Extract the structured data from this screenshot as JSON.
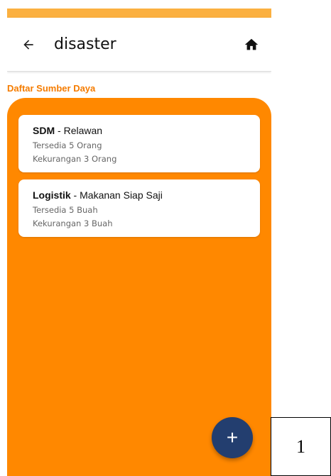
{
  "app_bar": {
    "title": "disaster",
    "back_icon": "arrow-left-icon",
    "home_icon": "home-icon"
  },
  "section_label": "Daftar Sumber Daya",
  "resources": [
    {
      "category": "SDM",
      "separator": " - ",
      "name": "Relawan",
      "available": "Tersedia 5 Orang",
      "shortage": "Kekurangan 3 Orang"
    },
    {
      "category": "Logistik",
      "separator": " - ",
      "name": "Makanan Siap Saji",
      "available": "Tersedia 5 Buah",
      "shortage": "Kekurangan 3 Buah"
    }
  ],
  "fab": {
    "label": "+",
    "icon": "plus-icon"
  },
  "page_number": "1",
  "colors": {
    "status_bar": "#fbb040",
    "panel": "#ff8800",
    "accent_text": "#f57c00",
    "fab": "#233e6f"
  }
}
